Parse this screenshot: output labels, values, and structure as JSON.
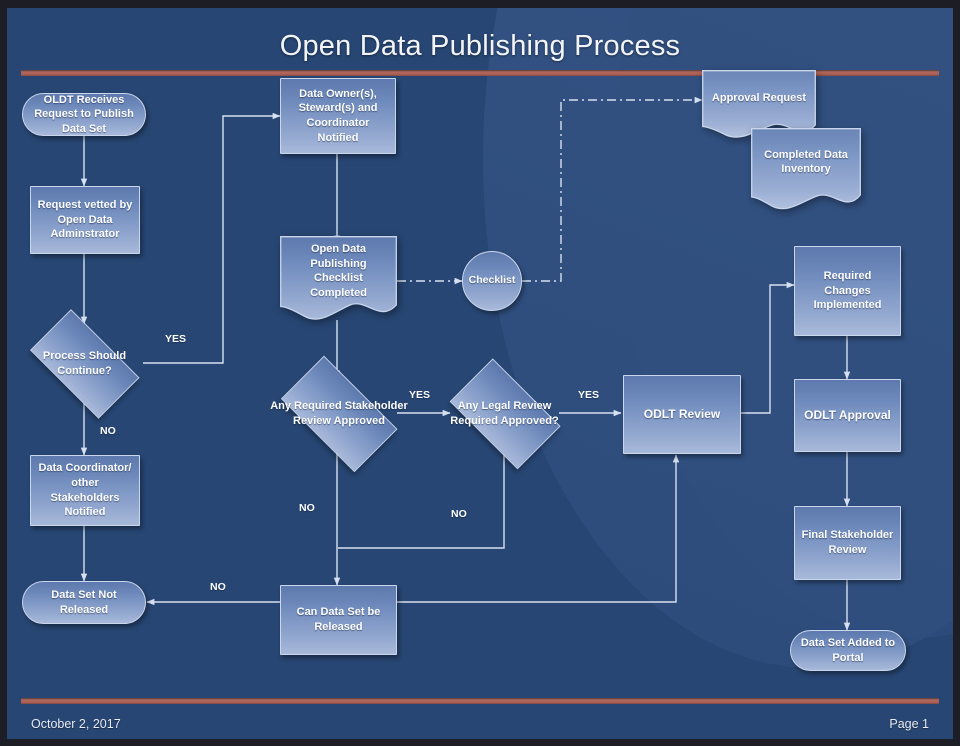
{
  "slide": {
    "title": "Open Data Publishing Process",
    "accent_color": "#a35b50",
    "background_color": "#274673",
    "shape_fill_top": "#5d79ad",
    "shape_fill_bottom": "#a8b9da",
    "footer": {
      "date": "October 2, 2017",
      "page": "Page 1"
    }
  },
  "nodes": [
    {
      "id": "start",
      "label": "OLDT Receives Request to Publish Data Set",
      "shape": "terminator"
    },
    {
      "id": "vetted",
      "label": "Request vetted by Open Data Adminstrator",
      "shape": "process"
    },
    {
      "id": "continue",
      "label": "Process Should Continue?",
      "shape": "decision"
    },
    {
      "id": "coordinator",
      "label": "Data Coordinator/ other Stakeholders Notified",
      "shape": "process"
    },
    {
      "id": "not-released",
      "label": "Data Set Not Released",
      "shape": "terminator"
    },
    {
      "id": "owners-notified",
      "label": "Data Owner(s), Steward(s) and Coordinator Notified",
      "shape": "process"
    },
    {
      "id": "checklist-done",
      "label": "Open Data Publishing Checklist Completed",
      "shape": "document"
    },
    {
      "id": "checklist",
      "label": "Checklist",
      "shape": "circle"
    },
    {
      "id": "stakeholder-review",
      "label": "Any Required Stakeholder Review Approved",
      "shape": "decision"
    },
    {
      "id": "legal-review",
      "label": "Any Legal Review Required Approved?",
      "shape": "decision"
    },
    {
      "id": "can-release",
      "label": "Can Data Set be Released",
      "shape": "process"
    },
    {
      "id": "odlt-review",
      "label": "ODLT Review",
      "shape": "process"
    },
    {
      "id": "approval-request",
      "label": "Approval Request",
      "shape": "document"
    },
    {
      "id": "data-inventory",
      "label": "Completed Data Inventory",
      "shape": "document"
    },
    {
      "id": "required-changes",
      "label": "Required Changes Implemented",
      "shape": "process"
    },
    {
      "id": "odlt-approval",
      "label": "ODLT Approval",
      "shape": "process"
    },
    {
      "id": "final-review",
      "label": "Final Stakeholder Review",
      "shape": "process"
    },
    {
      "id": "added-portal",
      "label": "Data Set Added to Portal",
      "shape": "terminator"
    }
  ],
  "edge_labels": {
    "continue_yes": "YES",
    "continue_no": "NO",
    "stakeholder_yes": "YES",
    "stakeholder_no": "NO",
    "legal_yes": "YES",
    "legal_no": "NO",
    "release_no": "NO"
  }
}
